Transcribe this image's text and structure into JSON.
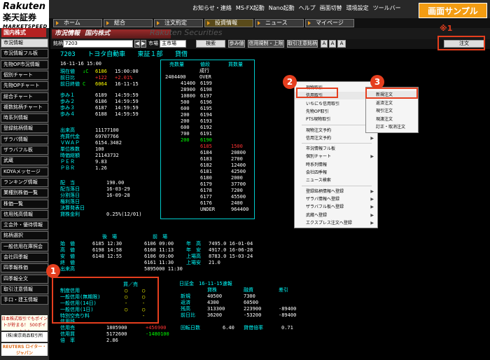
{
  "brand": {
    "line1": "Rakuten",
    "line2": "楽天証券",
    "line3": "MARKETSPEED"
  },
  "util_menu": [
    "お知らせ・連絡",
    "MS-FX起動",
    "Nano起動",
    "ヘルプ",
    "画面切替",
    "環境設定",
    "ツールバー"
  ],
  "sample_label": "画面サンプル",
  "tabs": [
    "ホーム",
    "総合",
    "注文約定",
    "投資情報",
    "ニュース",
    "マイページ"
  ],
  "sidebar": {
    "head": "国内株式",
    "items": [
      "市況情報",
      "市況情報フル板",
      "先物OP市況情報",
      "個別チャート",
      "先物OPチャート",
      "総合チャート",
      "複数銘柄チャート",
      "時系列情報",
      "登録銘柄情報",
      "ザラバ情報",
      "ザラバフル板",
      "武蔵",
      "KOYAメッセージ",
      "ランキング情報",
      "業種別株価一覧",
      "株価一覧",
      "信用残高情報",
      "立会外・優待情報",
      "銘柄選択",
      "一般信用在庫照会",
      "会社四季報",
      "四季報株価",
      "四季報全文",
      "取引注意情報",
      "手口・建玉情報"
    ],
    "ads": [
      "日本株式取引でもポイントが貯まる！ 500ポイント!",
      "(株)東京商品取引所",
      "REUTERS ロイター・ジャパン"
    ]
  },
  "window": {
    "title": "市況情報",
    "subtitle": "国内株式",
    "watermark": "Rakuten Securities"
  },
  "toolbar": {
    "code_label": "銘柄",
    "code_value": "7203",
    "market_label": "市場",
    "market_value": "主市場",
    "search_btn": "検索",
    "btn2": "歩み値",
    "btn3": "信用規制・上限",
    "btn4": "取引注意銘柄",
    "font_a1": "A",
    "font_a2": "A",
    "font_a3": "A",
    "order_btn": "注文"
  },
  "stock": {
    "code": "7203",
    "name": "トヨタ自動車",
    "market": "東証１部",
    "type": "貸借",
    "datetime": "16-11-16 15:00"
  },
  "price_rows": [
    {
      "label": "現在値",
      "mark": "↓C",
      "value": "6186",
      "time": "15:00:00"
    },
    {
      "label": "前日比",
      "mark": "",
      "value": "+122",
      "time": "+2.01%"
    },
    {
      "label": "前日終値",
      "mark": "C",
      "value": "6064",
      "time": "16-11-15"
    }
  ],
  "ticks": [
    {
      "label": "歩み１",
      "value": "6189",
      "time": "14:59:59"
    },
    {
      "label": "歩み２",
      "value": "6186",
      "time": "14:59:59"
    },
    {
      "label": "歩み３",
      "value": "6187",
      "time": "14:59:59"
    },
    {
      "label": "歩み４",
      "value": "6188",
      "time": "14:59:59"
    }
  ],
  "stats": [
    {
      "label": "出来高",
      "value": "11177100"
    },
    {
      "label": "売買代金",
      "value": "69707766"
    },
    {
      "label": "ＶＷＡＰ",
      "value": "6154.3482"
    },
    {
      "label": "単位株数",
      "value": "100"
    },
    {
      "label": "時価総額",
      "value": "21143732"
    },
    {
      "label": "ＰＥＲ",
      "value": "9.83"
    },
    {
      "label": "ＰＢＲ",
      "value": "1.26"
    }
  ],
  "dividend": [
    {
      "label": "配　当",
      "value": "190.00"
    },
    {
      "label": "配当落日",
      "value": "16-03-29"
    },
    {
      "label": "分割落日",
      "value": "16-09-28"
    },
    {
      "label": "権利落日",
      "value": ""
    },
    {
      "label": "決算発表日",
      "value": ""
    },
    {
      "label": "貸株金利",
      "value": "0.25%(12/01)"
    }
  ],
  "board": {
    "headers": {
      "sell": "売数量",
      "price": "値段",
      "buy": "買数量"
    },
    "market_label": "成行",
    "over": "OVER",
    "under": "UNDER",
    "over_qty": "2404400",
    "under_qty": "964400",
    "sell": [
      {
        "qty": "41400",
        "price": "6199"
      },
      {
        "qty": "28900",
        "price": "6198"
      },
      {
        "qty": "10800",
        "price": "6197"
      },
      {
        "qty": "500",
        "price": "6196"
      },
      {
        "qty": "600",
        "price": "6195"
      },
      {
        "qty": "200",
        "price": "6194"
      },
      {
        "qty": "200",
        "price": "6193"
      },
      {
        "qty": "600",
        "price": "6192"
      },
      {
        "qty": "700",
        "price": "6191"
      },
      {
        "qty": "200",
        "price": "6190"
      }
    ],
    "buy": [
      {
        "price": "6185",
        "qty": "1500"
      },
      {
        "price": "6184",
        "qty": "20800"
      },
      {
        "price": "6183",
        "qty": "2700"
      },
      {
        "price": "6182",
        "qty": "12400"
      },
      {
        "price": "6181",
        "qty": "42500"
      },
      {
        "price": "6180",
        "qty": "2000"
      },
      {
        "price": "6179",
        "qty": "37700"
      },
      {
        "price": "6178",
        "qty": "7200"
      },
      {
        "price": "6177",
        "qty": "45500"
      },
      {
        "price": "6176",
        "qty": "2400"
      }
    ]
  },
  "sessions": {
    "headers": {
      "pm": "後　場",
      "am": "前　場"
    },
    "rows": [
      {
        "label": "始　値",
        "pm": "6185 12:30",
        "am": "6106 09:00",
        "lbl2": "年　高",
        "v2": "7495.0 16-01-04"
      },
      {
        "label": "高　値",
        "pm": "6198 14:58",
        "am": "6168 11:13",
        "lbl2": "年　安",
        "v2": "4917.0 16-06-28"
      },
      {
        "label": "安　値",
        "pm": "6148 12:55",
        "am": "6106 09:00",
        "lbl2": "上場高",
        "v2": "8783.0 15-03-24"
      },
      {
        "label": "終　値",
        "pm": "",
        "am": "6161 11:30",
        "lbl2": "上場安",
        "v2": "21.0"
      },
      {
        "label": "出来高",
        "pm": "",
        "am": "5895000 11:30",
        "lbl2": "",
        "v2": ""
      }
    ]
  },
  "credit": {
    "headers": {
      "buy_sell": "買／売"
    },
    "rows": [
      {
        "label": "制度信用",
        "buy": "◯",
        "sell": "◯"
      },
      {
        "label": "一般信用(無期限)",
        "buy": "◯",
        "sell": "◯"
      },
      {
        "label": "一般信用(14日)",
        "buy": "-",
        "sell": "-"
      },
      {
        "label": "一般信用(1日)",
        "buy": "◯",
        "sell": "◯"
      },
      {
        "label": "特別空売り料",
        "buy": "",
        "sell": "-"
      }
    ]
  },
  "margin": {
    "title": "日証金　16-11-15速報",
    "headers": {
      "loan": "貸株",
      "finance": "融資",
      "diff": "差引"
    },
    "rows": [
      {
        "label": "新規",
        "loan": "40500",
        "finance": "7300",
        "diff": ""
      },
      {
        "label": "返済",
        "loan": "4300",
        "finance": "60500",
        "diff": ""
      },
      {
        "label": "残高",
        "loan": "313300",
        "finance": "223900",
        "diff": "-89400"
      },
      {
        "label": "前日比",
        "loan": "36200",
        "finance": "-53200",
        "diff": "-89400"
      }
    ]
  },
  "margin_balance": {
    "rows": [
      {
        "label": "信用売",
        "value": "1805900",
        "change": "+456900"
      },
      {
        "label": "信用買",
        "value": "5172600",
        "change": "-1480100"
      },
      {
        "label": "倍　率",
        "value": "2.86",
        "change": ""
      }
    ],
    "rotation_label": "回転日数",
    "rotation_value": "6.40",
    "lending_label": "貸借倍率",
    "lending_value": "0.71",
    "section_label": "信用残"
  },
  "context_menu": {
    "items": [
      "現物取引",
      "信用取引",
      "いちにち信用取引",
      "先物OP取引",
      "PTS現物取引",
      "現物注文予約",
      "信用注文予約",
      "市況情報フル板",
      "個別チャート",
      "時系列情報",
      "会社四季報",
      "ニュース検索",
      "登録銘柄情報へ登録",
      "ザラバ情報へ登録",
      "ザラバフル板へ登録",
      "武蔵へ登録",
      "エクスプレス注文へ登録"
    ],
    "submenu_items": [
      false,
      true,
      true,
      true,
      true,
      false,
      true,
      false,
      true,
      false,
      false,
      false,
      true,
      true,
      true,
      true,
      true
    ]
  },
  "submenu": {
    "items": [
      "新規注文",
      "返済注文",
      "現引注文",
      "現渡注文",
      "訂正・取消注文"
    ]
  },
  "annotations": {
    "b1": "1",
    "b2": "2",
    "b3": "3",
    "note": "※1"
  }
}
